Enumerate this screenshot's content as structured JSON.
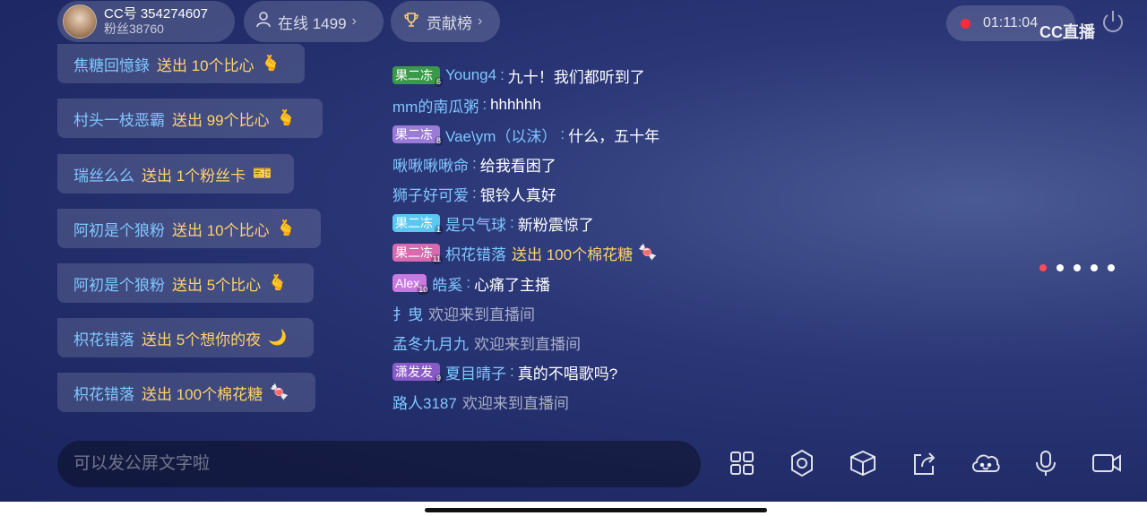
{
  "streamer": {
    "id": "CC号 354274607",
    "fans": "粉丝38760"
  },
  "online": {
    "label": "在线 1499"
  },
  "rank": {
    "label": "贡献榜"
  },
  "timer": "01:11:04",
  "logo": "CC直播",
  "gifts": [
    {
      "user": "焦糖回憶錄",
      "text": "送出 10个比心",
      "icon": "heart-hand-gift-icon"
    },
    {
      "user": "村头一枝恶霸",
      "text": "送出 99个比心",
      "icon": "heart-hand-gift-icon"
    },
    {
      "user": "瑞丝么么",
      "text": "送出 1个粉丝卡",
      "icon": "fan-card-gift-icon"
    },
    {
      "user": "阿初是个狼粉",
      "text": "送出 10个比心",
      "icon": "heart-hand-gift-icon"
    },
    {
      "user": "阿初是个狼粉",
      "text": "送出 5个比心",
      "icon": "heart-hand-gift-icon"
    },
    {
      "user": "枳花错落",
      "text": "送出 5个想你的夜",
      "icon": "night-gift-icon"
    },
    {
      "user": "枳花错落",
      "text": "送出 100个棉花糖",
      "icon": "cotton-candy-gift-icon"
    }
  ],
  "chat": [
    {
      "badge": "果二冻",
      "badge_level": "6",
      "badge_color": "#3a9a4a",
      "user": "Young4",
      "message": "九十！我们都听到了"
    },
    {
      "user": "mm的南瓜粥",
      "message": "hhhhhh"
    },
    {
      "badge": "果二冻",
      "badge_level": "8",
      "badge_color": "#9b7ad8",
      "user": "Vae\\ym（以沫）",
      "message": "什么，五十年"
    },
    {
      "user": "啾啾啾啾命",
      "message": "给我看困了"
    },
    {
      "user": "狮子好可爱",
      "message": "银铃人真好"
    },
    {
      "badge": "果二冻",
      "badge_level": "1",
      "badge_color": "#5ac8f0",
      "user": "是只气球",
      "message": "新粉震惊了"
    },
    {
      "badge": "果二冻",
      "badge_level": "11",
      "badge_color": "#d86ab0",
      "user": "枳花错落",
      "gift": "送出 100个棉花糖"
    },
    {
      "badge": "Alex",
      "badge_level": "10",
      "badge_color": "#c87ae0",
      "user": "皓奚",
      "message": "心痛了主播"
    },
    {
      "user": "扌曳",
      "system": "欢迎来到直播间"
    },
    {
      "user": "孟冬九月九",
      "system": "欢迎来到直播间"
    },
    {
      "badge": "潇发发",
      "badge_level": "9",
      "badge_color": "#8a5ac8",
      "user": "夏目晴子",
      "message": "真的不唱歌吗?"
    },
    {
      "user": "路人3187",
      "system": "欢迎来到直播间"
    }
  ],
  "input": {
    "placeholder": "可以发公屏文字啦"
  },
  "toolbar": [
    "apps-icon",
    "settings-icon",
    "gift-box-icon",
    "share-icon",
    "emoji-cloud-icon",
    "microphone-icon",
    "camera-icon"
  ],
  "pager": {
    "count": 5,
    "active": 0
  },
  "colors": {
    "accent": "#ffd36b",
    "username": "#7fc7ff",
    "record": "#ff2b3a"
  }
}
